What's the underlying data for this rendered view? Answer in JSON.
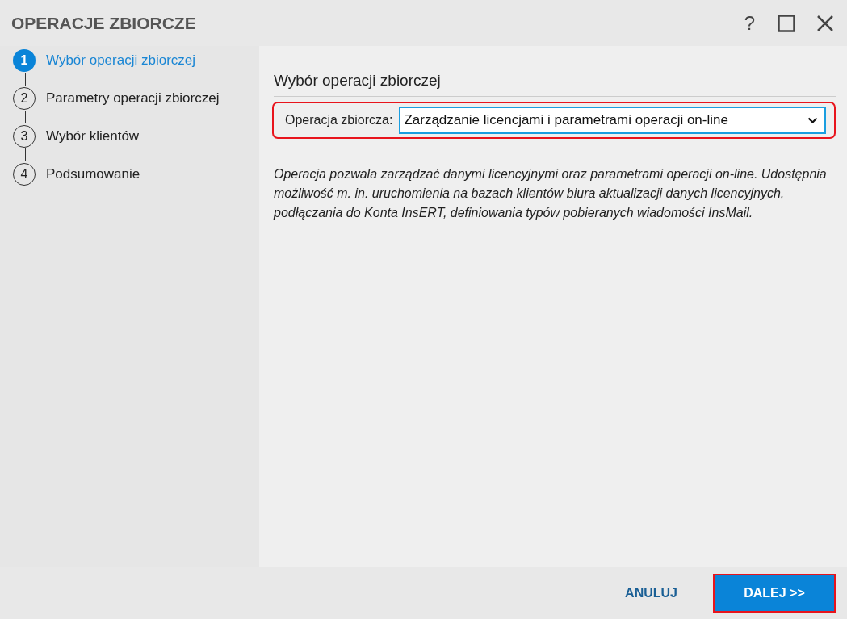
{
  "window": {
    "title": "OPERACJE ZBIORCZE",
    "help": "?"
  },
  "steps": [
    {
      "number": "1",
      "label": "Wybór operacji zbiorczej",
      "selected": true
    },
    {
      "number": "2",
      "label": "Parametry operacji zbiorczej",
      "selected": false
    },
    {
      "number": "3",
      "label": "Wybór klientów",
      "selected": false
    },
    {
      "number": "4",
      "label": "Podsumowanie",
      "selected": false
    }
  ],
  "section": {
    "title": "Wybór operacji zbiorczej",
    "field": {
      "label": "Operacja zbiorcza:",
      "value": "Zarządzanie licencjami i parametrami operacji on-line",
      "highlighted": true
    },
    "description": "Operacja pozwala zarządzać danymi licencyjnymi oraz parametrami operacji on-line. Udostępnia możliwość m. in. uruchomienia na bazach klientów biura aktualizacji danych licencyjnych, podłączania do Konta InsERT, definiowania typów pobieranych wiadomości InsMail."
  },
  "buttons": [
    {
      "label": "ANULUJ",
      "kind": "text",
      "highlighted": false
    },
    {
      "label": "DALEJ >>",
      "kind": "primary",
      "highlighted": true
    }
  ]
}
